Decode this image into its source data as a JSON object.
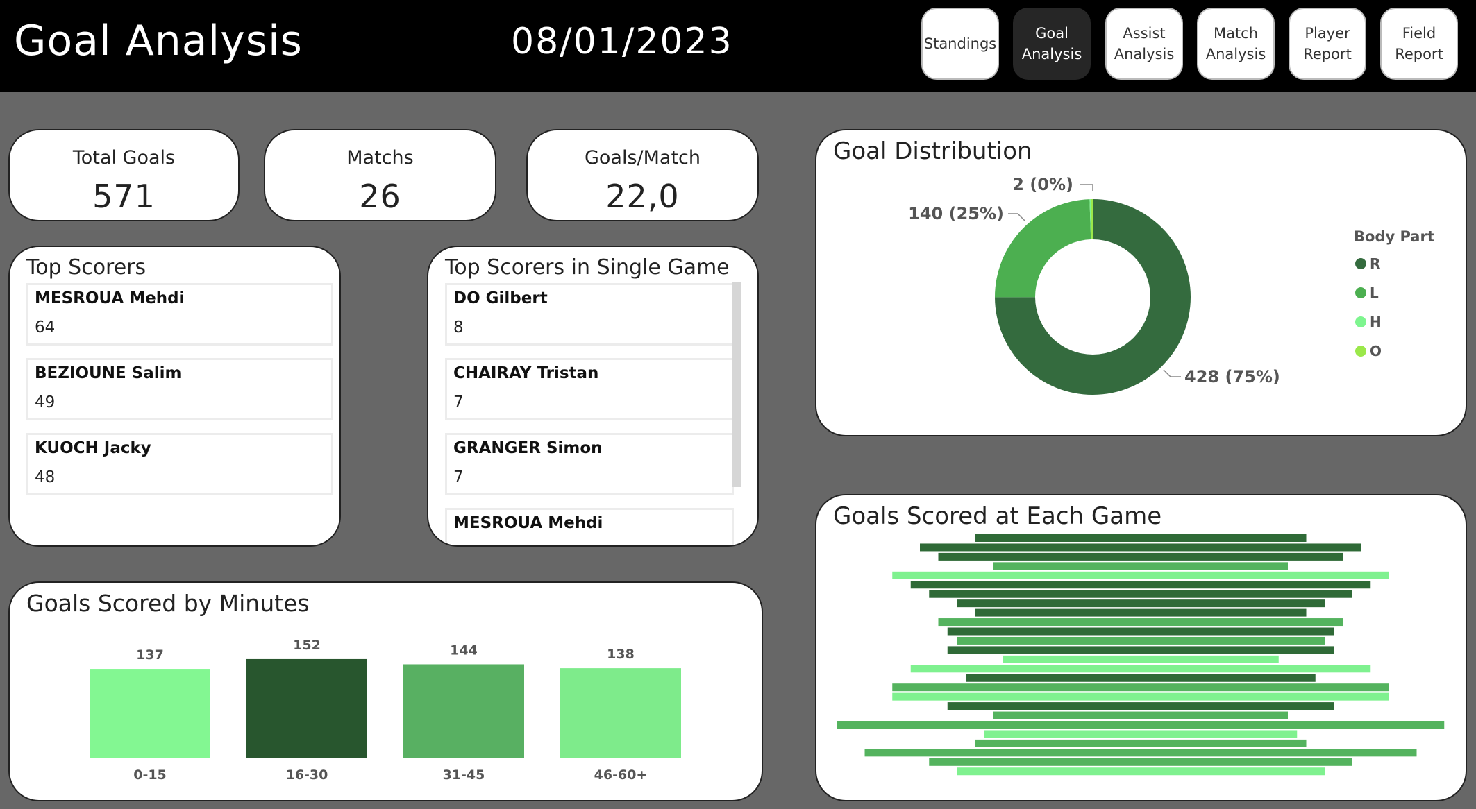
{
  "header": {
    "title": "Goal Analysis",
    "date": "08/01/2023",
    "nav": [
      {
        "label": "Standings",
        "active": false
      },
      {
        "label": "Goal\nAnalysis",
        "active": true
      },
      {
        "label": "Assist\nAnalysis",
        "active": false
      },
      {
        "label": "Match\nAnalysis",
        "active": false
      },
      {
        "label": "Player\nReport",
        "active": false
      },
      {
        "label": "Field\nReport",
        "active": false
      }
    ]
  },
  "kpis": {
    "total_goals": {
      "label": "Total Goals",
      "value": "571"
    },
    "matches": {
      "label": "Matchs",
      "value": "26"
    },
    "goals_per_match": {
      "label": "Goals/Match",
      "value": "22,0"
    }
  },
  "top_scorers": {
    "title": "Top Scorers",
    "items": [
      {
        "name": "MESROUA Mehdi",
        "value": "64"
      },
      {
        "name": "BEZIOUNE Salim",
        "value": "49"
      },
      {
        "name": "KUOCH Jacky",
        "value": "48"
      }
    ]
  },
  "top_single_game": {
    "title": "Top Scorers in Single Game",
    "items": [
      {
        "name": "DO Gilbert",
        "value": "8"
      },
      {
        "name": "CHAIRAY Tristan",
        "value": "7"
      },
      {
        "name": "GRANGER Simon",
        "value": "7"
      },
      {
        "name": "MESROUA Mehdi",
        "value": ""
      }
    ]
  },
  "colors": {
    "R": "#346b3e",
    "L": "#4caf50",
    "H": "#7ef58f",
    "O": "#9be84a",
    "dark": "#28562e",
    "mid": "#58b062",
    "light": "#83f792",
    "light2": "#7eeb8b"
  },
  "chart_data": [
    {
      "type": "pie",
      "title": "Goal Distribution",
      "legend_title": "Body Part",
      "legend_position": "right",
      "labels": [
        "R",
        "L",
        "H",
        "O"
      ],
      "values": [
        428,
        140,
        1,
        2
      ],
      "data_labels": [
        "428 (75%)",
        "140 (25%)",
        "",
        "2 (0%)"
      ]
    },
    {
      "type": "bar",
      "title": "Goals Scored by Minutes",
      "categories": [
        "0-15",
        "16-30",
        "31-45",
        "46-60+"
      ],
      "values": [
        137,
        152,
        144,
        138
      ],
      "bar_colors": [
        "light",
        "dark",
        "mid",
        "light2"
      ],
      "ylim": [
        0,
        170
      ]
    },
    {
      "type": "bar",
      "title": "Goals Scored at Each Game",
      "orientation": "horizontal-centered",
      "values": [
        18,
        24,
        22,
        16,
        27,
        25,
        23,
        20,
        18,
        22,
        21,
        20,
        21,
        15,
        25,
        19,
        27,
        27,
        21,
        16,
        33,
        17,
        18,
        30,
        23,
        20
      ],
      "shades": [
        "R",
        "R",
        "R",
        "L",
        "H",
        "R",
        "R",
        "R",
        "R",
        "L",
        "R",
        "L",
        "R",
        "H",
        "H",
        "R",
        "L",
        "H",
        "R",
        "L",
        "L",
        "H",
        "L",
        "L",
        "L",
        "H"
      ]
    }
  ]
}
